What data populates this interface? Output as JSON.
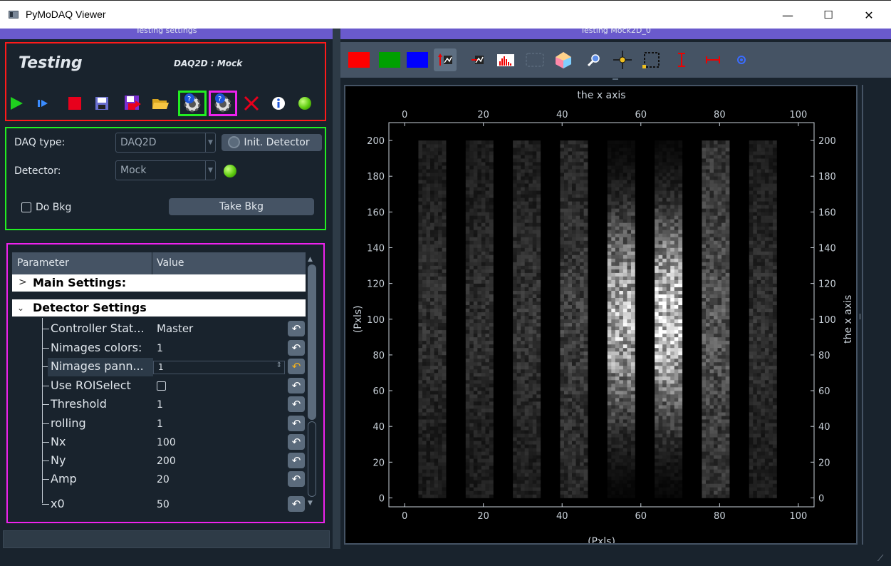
{
  "window": {
    "title": "PyMoDAQ Viewer",
    "minimize": "—",
    "maximize": "☐",
    "close": "✕"
  },
  "left_dock": {
    "title": "Testing settings",
    "header": {
      "name": "Testing",
      "daq_label": "DAQ2D : Mock"
    },
    "daq_type_label": "DAQ type:",
    "daq_type_value": "DAQ2D",
    "init_button": "Init. Detector",
    "detector_label": "Detector:",
    "detector_value": "Mock",
    "do_bkg_label": "Do Bkg",
    "take_bkg_button": "Take Bkg",
    "tree": {
      "col_param": "Parameter",
      "col_value": "Value",
      "main_settings": "Main Settings:",
      "detector_settings": "Detector Settings",
      "rows": [
        {
          "name": "Controller Stat...",
          "value": "Master"
        },
        {
          "name": "Nimages colors:",
          "value": "1"
        },
        {
          "name": "Nimages pann...",
          "value": "1"
        },
        {
          "name": "Use ROISelect",
          "value": ""
        },
        {
          "name": "Threshold",
          "value": "1"
        },
        {
          "name": "rolling",
          "value": "1"
        },
        {
          "name": "Nx",
          "value": "100"
        },
        {
          "name": "Ny",
          "value": "200"
        },
        {
          "name": "Amp",
          "value": "20"
        },
        {
          "name": "x0",
          "value": "50"
        }
      ]
    }
  },
  "right_dock": {
    "title": "Testing Mock2D_0"
  },
  "chart_data": {
    "type": "heatmap",
    "top_axis_label": "the x axis",
    "bottom_axis_label": "(Pxls)",
    "left_axis_label": "(Pxls)",
    "right_axis_label": "the x axis",
    "x_ticks": [
      0,
      20,
      40,
      60,
      80,
      100
    ],
    "y_ticks": [
      0,
      20,
      40,
      60,
      80,
      100,
      120,
      140,
      160,
      180,
      200
    ],
    "xlim": [
      -4,
      104
    ],
    "ylim": [
      -5,
      210
    ],
    "bands_x_center": [
      7,
      19,
      31,
      43,
      55,
      67,
      79,
      91
    ],
    "bands_peak_intensity": [
      0.22,
      0.22,
      0.24,
      0.3,
      0.85,
      0.95,
      0.4,
      0.22
    ],
    "gaussian_y_center": 100,
    "colormap": "grey"
  }
}
